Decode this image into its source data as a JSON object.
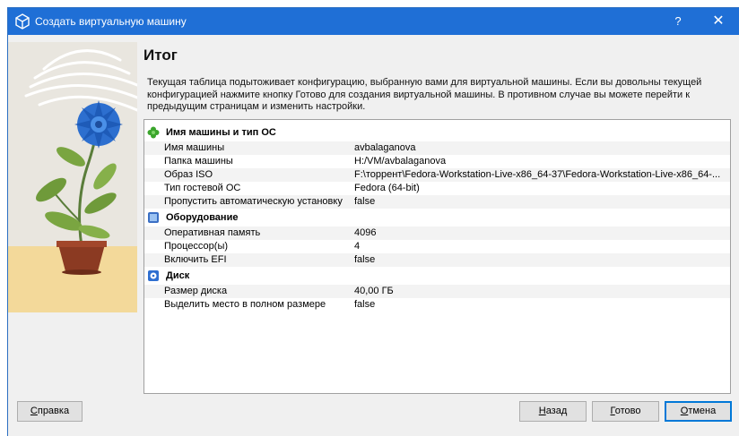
{
  "window": {
    "title": "Создать виртуальную машину",
    "help_label": "?",
    "close_label": "✕"
  },
  "page": {
    "title": "Итог",
    "description": "Текущая таблица подытоживает конфигурацию, выбранную вами для виртуальной машины. Если вы довольны текущей конфигурацией нажмите кнопку Готово для создания виртуальной машины. В противном случае вы можете перейти к предыдущим страницам и изменить настройки."
  },
  "sections": [
    {
      "title": "Имя машины и тип ОС",
      "icon": "green-puzzle-icon",
      "rows": [
        {
          "key": "Имя машины",
          "value": "avbalaganova"
        },
        {
          "key": "Папка машины",
          "value": "H:/VM/avbalaganova"
        },
        {
          "key": "Образ ISO",
          "value": "F:\\торрент\\Fedora-Workstation-Live-x86_64-37\\Fedora-Workstation-Live-x86_64-..."
        },
        {
          "key": "Тип гостевой ОС",
          "value": "Fedora (64-bit)"
        },
        {
          "key": "Пропустить автоматическую установку",
          "value": "false"
        }
      ]
    },
    {
      "title": "Оборудование",
      "icon": "chip-icon",
      "rows": [
        {
          "key": "Оперативная память",
          "value": "4096"
        },
        {
          "key": "Процессор(ы)",
          "value": "4"
        },
        {
          "key": "Включить EFI",
          "value": "false"
        }
      ]
    },
    {
      "title": "Диск",
      "icon": "disk-icon",
      "rows": [
        {
          "key": "Размер диска",
          "value": "40,00 ГБ"
        },
        {
          "key": "Выделить место в полном размере",
          "value": "false"
        }
      ]
    }
  ],
  "buttons": {
    "help_first": "С",
    "help_rest": "правка",
    "back_first": "Н",
    "back_rest": "азад",
    "finish_first": "Г",
    "finish_rest": "отово",
    "cancel_first": "О",
    "cancel_rest": "тмена"
  },
  "colors": {
    "titlebar": "#1f6fd6",
    "accent": "#0078d7"
  }
}
